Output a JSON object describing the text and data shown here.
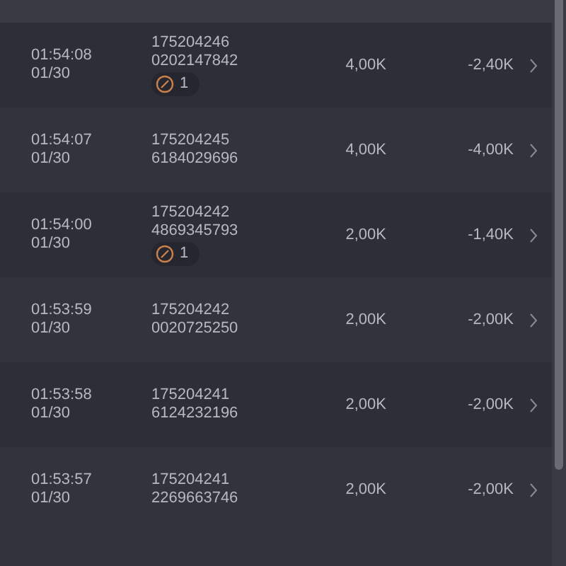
{
  "rows": [
    {
      "time": "01:54:08",
      "date": "01/30",
      "id_line_1": "175204246",
      "id_line_2": "0202147842",
      "badge": "1",
      "amount": "4,00K",
      "change": "-2,40K"
    },
    {
      "time": "01:54:07",
      "date": "01/30",
      "id_line_1": "175204245",
      "id_line_2": "6184029696",
      "amount": "4,00K",
      "change": "-4,00K"
    },
    {
      "time": "01:54:00",
      "date": "01/30",
      "id_line_1": "175204242",
      "id_line_2": "4869345793",
      "badge": "1",
      "amount": "2,00K",
      "change": "-1,40K"
    },
    {
      "time": "01:53:59",
      "date": "01/30",
      "id_line_1": "175204242",
      "id_line_2": "0020725250",
      "amount": "2,00K",
      "change": "-2,00K"
    },
    {
      "time": "01:53:58",
      "date": "01/30",
      "id_line_1": "175204241",
      "id_line_2": "6124232196",
      "amount": "2,00K",
      "change": "-2,00K"
    },
    {
      "time": "01:53:57",
      "date": "01/30",
      "id_line_1": "175204241",
      "id_line_2": "2269663746",
      "amount": "2,00K",
      "change": "-2,00K"
    }
  ]
}
